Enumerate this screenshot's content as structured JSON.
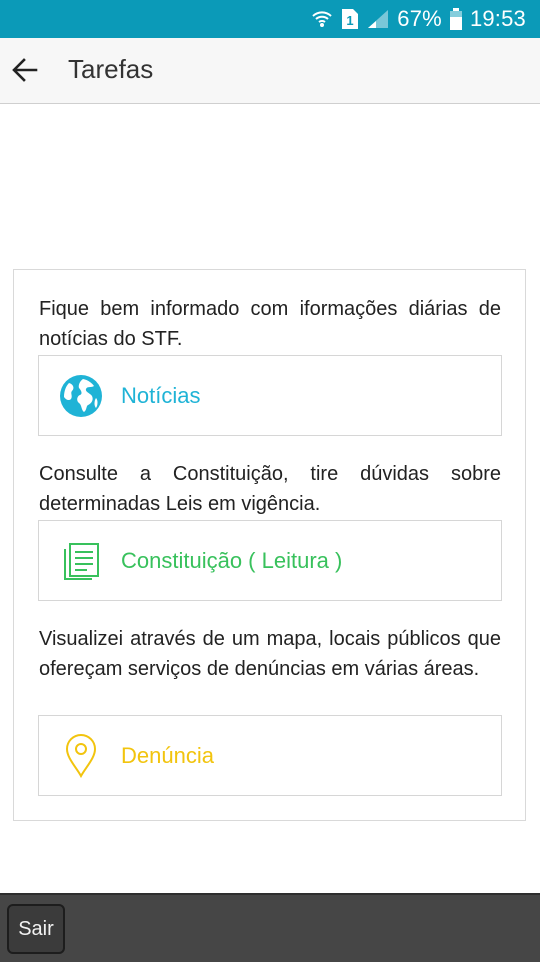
{
  "status_bar": {
    "battery": "67%",
    "time": "19:53",
    "sim_slot": "1",
    "icons": [
      "wifi-icon",
      "sim-icon",
      "signal-icon",
      "battery-icon"
    ]
  },
  "app_bar": {
    "title": "Tarefas",
    "back_icon": "arrow-back-icon"
  },
  "tasks": [
    {
      "description": "Fique bem informado com iformações diárias de notícias do STF.",
      "label": "Notícias",
      "icon": "globe-icon",
      "color": "#1fb3d6"
    },
    {
      "description": "Consulte a Constituição, tire dúvidas sobre determinadas Leis em vigência.",
      "label": "Constituição ( Leitura )",
      "icon": "document-icon",
      "color": "#38c15c"
    },
    {
      "description": "Visualizei através de um mapa, locais públicos que ofereçam serviços de denúncias em várias áreas.",
      "label": "Denúncia",
      "icon": "location-pin-icon",
      "color": "#f2c40e"
    }
  ],
  "bottom_bar": {
    "exit_label": "Sair"
  },
  "colors": {
    "status_bar": "#0b9ab8",
    "app_bar": "#f7f7f7",
    "bottom_bar": "#464646"
  }
}
